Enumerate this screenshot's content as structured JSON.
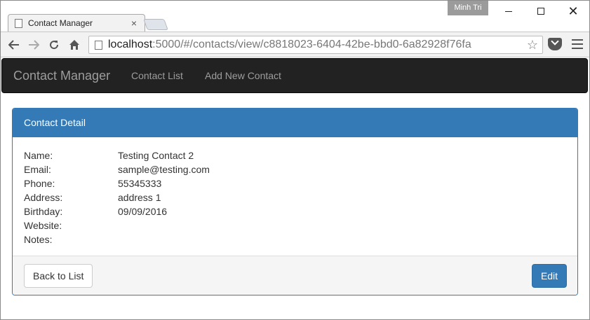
{
  "window": {
    "user_badge": "Minh Tri",
    "tab_title": "Contact Manager"
  },
  "toolbar": {
    "url_host": "localhost",
    "url_rest": ":5000/#/contacts/view/c8818023-6404-42be-bbd0-6a82928f76fa"
  },
  "navbar": {
    "brand": "Contact Manager",
    "links": [
      "Contact List",
      "Add New Contact"
    ]
  },
  "panel": {
    "heading": "Contact Detail",
    "fields": [
      {
        "label": "Name:",
        "value": "Testing Contact 2"
      },
      {
        "label": "Email:",
        "value": "sample@testing.com"
      },
      {
        "label": "Phone:",
        "value": "55345333"
      },
      {
        "label": "Address:",
        "value": "address 1"
      },
      {
        "label": "Birthday:",
        "value": "09/09/2016"
      },
      {
        "label": "Website:",
        "value": ""
      },
      {
        "label": "Notes:",
        "value": ""
      }
    ],
    "back_label": "Back to List",
    "edit_label": "Edit"
  },
  "colors": {
    "navbar_bg": "#222222",
    "primary": "#337ab7",
    "footer_bg": "#f5f5f5"
  }
}
